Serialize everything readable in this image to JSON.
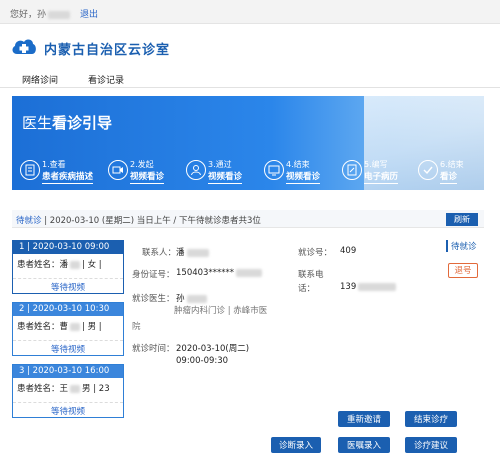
{
  "topbar": {
    "greeting": "您好，孙",
    "logout": "退出"
  },
  "brand": {
    "title": "内蒙古自治区云诊室"
  },
  "tabs": [
    "网络诊间",
    "看诊记录"
  ],
  "banner": {
    "title_plain": "医生",
    "title_bold": "看诊引导",
    "steps": [
      {
        "line1": "1.查看",
        "line2": "患者疾病描述",
        "icon": "document-icon"
      },
      {
        "line1": "2.发起",
        "line2": "视频看诊",
        "icon": "video-call-icon"
      },
      {
        "line1": "3.通过",
        "line2": "视频看诊",
        "icon": "consult-icon"
      },
      {
        "line1": "4.结束",
        "line2": "视频看诊",
        "icon": "end-video-icon"
      },
      {
        "line1": "5.编写",
        "line2": "电子病历",
        "icon": "edit-record-icon"
      },
      {
        "line1": "6.结束",
        "line2": "看诊",
        "icon": "finish-icon"
      }
    ]
  },
  "wait": {
    "label": "待就诊",
    "info": "| 2020-03-10 (星期二) 当日上午 / 下午待就诊患者共3位",
    "refresh": "刷新"
  },
  "queue": [
    {
      "header": "1 | 2020-03-10 09:00",
      "patient": "患者姓名：潘",
      "tail": "| 女 |",
      "status": "等待视频"
    },
    {
      "header": "2 | 2020-03-10 10:30",
      "patient": "患者姓名：曹",
      "tail": "| 男 |",
      "status": "等待视频"
    },
    {
      "header": "3 | 2020-03-10 16:00",
      "patient": "患者姓名：王",
      "tail": "男 | 23",
      "status": "等待视频"
    }
  ],
  "detail": {
    "contact_label": "联系人：",
    "contact_value": "潘",
    "visit_no_label": "就诊号：",
    "visit_no_value": "409",
    "id_label": "身份证号：",
    "id_value": "150403******",
    "phone_label": "联系电",
    "phone_label2": "话：",
    "phone_value": "139",
    "doctor_label": "就诊医生：",
    "doctor_value": "孙",
    "hospital_line1": "肿瘤内科门诊 | 赤峰市医",
    "hospital_line2": "院",
    "time_label": "就诊时间：",
    "time_value1": "2020-03-10(周二)",
    "time_value2": "09:00-09:30"
  },
  "side": {
    "wait": "待就诊",
    "back": "退号"
  },
  "buttons": {
    "reinvite": "重新邀请",
    "end": "结束诊疗",
    "diagnosis": "诊断录入",
    "order": "医嘱录入",
    "advice": "诊疗建议"
  }
}
